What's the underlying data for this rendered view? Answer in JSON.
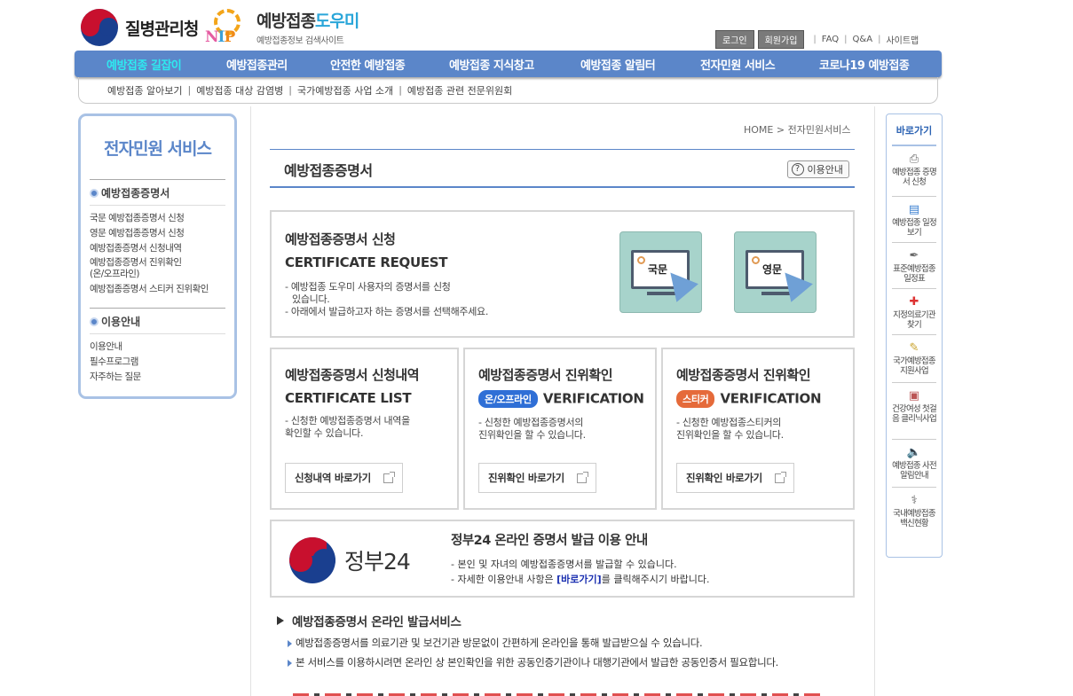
{
  "header": {
    "kdca_name": "질병관리청",
    "nip_title_main": "예방접종",
    "nip_title_accent": "도우미",
    "nip_sub": "예방접종정보 검색사이트",
    "nip_letters": [
      "N",
      "I",
      "P"
    ],
    "util": {
      "login": "로그인",
      "join": "회원가입",
      "faq": "FAQ",
      "qna": "Q&A",
      "sitemap": "사이트맵"
    }
  },
  "gnb": [
    "예방접종 길잡이",
    "예방접종관리",
    "안전한 예방접종",
    "예방접종 지식창고",
    "예방접종 알림터",
    "전자민원 서비스",
    "코로나19 예방접종"
  ],
  "subnav": [
    "예방접종 알아보기",
    "예방접종 대상 감염병",
    "국가예방접종 사업 소개",
    "예방접종 관련 전문위원회"
  ],
  "lnb": {
    "title": "전자민원 서비스",
    "sections": [
      {
        "head": "예방접종증명서",
        "items": [
          "국문 예방접종증명서 신청",
          "영문 예방접종증명서 신청",
          "예방접종증명서 신청내역",
          "예방접종증명서 진위확인",
          "(온/오프라인)",
          "예방접종증명서 스티커 진위확인"
        ]
      },
      {
        "head": "이용안내",
        "items": [
          "이용안내",
          "필수프로그램",
          "자주하는 질문"
        ]
      }
    ]
  },
  "breadcrumb": {
    "home": "HOME",
    "sep": ">",
    "current": "전자민원서비스"
  },
  "page": {
    "title": "예방접종증명서",
    "help": "이용안내",
    "help_icon": "?"
  },
  "request": {
    "title": "예방접종증명서 신청",
    "en": "CERTIFICATE REQUEST",
    "desc1": "- 예방접종 도우미 사용자의 증명서를 신청",
    "desc2": "  있습니다.",
    "desc3": "- 아래에서 발급하고자 하는 증명서를 선택해주세요.",
    "kor": "국문",
    "eng": "영문"
  },
  "cards": [
    {
      "title": "예방접종증명서 신청내역",
      "pill": "",
      "en": "CERTIFICATE LIST",
      "desc1": "- 신청한 예방접종증명서 내역을",
      "desc2": "   확인할 수 있습니다.",
      "button": "신청내역 바로가기"
    },
    {
      "title": "예방접종증명서 진위확인",
      "pill": "온/오프라인",
      "en": "VERIFICATION",
      "desc1": "- 신청한 예방접종증명서의",
      "desc2": "  진위확인을 할 수 있습니다.",
      "button": "진위확인 바로가기"
    },
    {
      "title": "예방접종증명서 진위확인",
      "pill": "스티커",
      "en": "VERIFICATION",
      "desc1": "- 신청한 예방접종스티커의",
      "desc2": "  진위확인을 할 수 있습니다.",
      "button": "진위확인 바로가기"
    }
  ],
  "gov24": {
    "logo_text": "정부24",
    "title": "정부24 온라인 증명서 발급 이용 안내",
    "line1": "- 본인 및 자녀의 예방접종증명서를 발급할 수 있습니다.",
    "line2_pre": "- 자세한 이용안내 사항은 ",
    "line2_link": "[바로가기]",
    "line2_post": "를 클릭해주시기 바랍니다."
  },
  "online": {
    "head": "예방접종증명서 온라인 발급서비스",
    "b1": "예방접종증명서를 의료기관 및 보건기관 방문없이 간편하게 온라인을 통해 발급받으실 수 있습니다.",
    "b2": "본 서비스를 이용하시려면 온라인 상 본인확인을 위한 공동인증기관이나 대행기관에서 발급한 공동인증서 필요합니다."
  },
  "quick": {
    "title": "바로가기",
    "items": [
      {
        "icon": "printer-icon",
        "label": "예방접종 증명서 신청"
      },
      {
        "icon": "calendar-icon",
        "label": "예방접종 일정보기"
      },
      {
        "icon": "syringe-icon",
        "label": "표준예방접종 일정표"
      },
      {
        "icon": "hospital-icon",
        "label": "지정의료기관 찾기"
      },
      {
        "icon": "document-icon",
        "label": "국가예방접종 지원사업"
      },
      {
        "icon": "box-icon",
        "label": "건강여성 첫걸음 클리닉사업"
      },
      {
        "icon": "speaker-icon",
        "label": "예방접종 사전알림안내"
      },
      {
        "icon": "vial-icon",
        "label": "국내예방접종 백신현황"
      }
    ]
  },
  "colors": {
    "brand": "#5b86c9",
    "active": "#2eeaf0",
    "pill_blue": "#2f6fd6",
    "pill_orange": "#e56a3a",
    "link": "#1a2fb0"
  }
}
